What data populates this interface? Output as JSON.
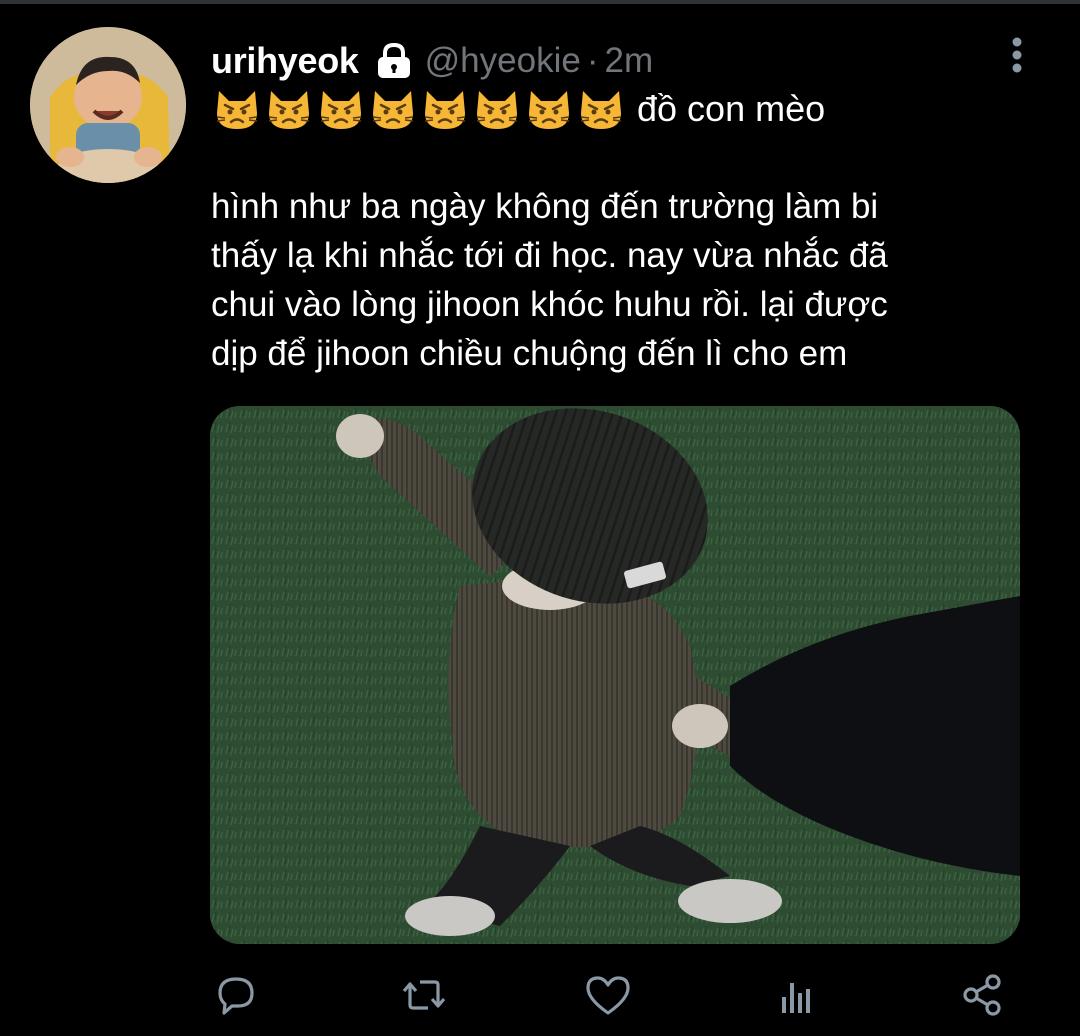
{
  "tweet": {
    "display_name": "urihyeok",
    "name_suffix": "đồ con mèo",
    "handle": "@hyeokie",
    "separator": "·",
    "time": "2m",
    "text_lines": [
      "hình như ba ngày không đến trường làm bi",
      "thấy lạ khi nhắc tới đi học. nay vừa nhắc đã",
      "chui vào lòng jihoon khóc huhu rồi. lại được",
      "dịp để jihoon chiều chuộng đến lì cho em"
    ],
    "name_emoji": [
      "pouting-cat",
      "pouting-cat",
      "pouting-cat",
      "pouting-cat",
      "pouting-cat",
      "pouting-cat",
      "pouting-cat",
      "pouting-cat"
    ],
    "protected": true
  },
  "icons": {
    "lock": "lock-icon",
    "more": "more-vertical-icon",
    "reply": "reply-icon",
    "retweet": "retweet-icon",
    "like": "heart-icon",
    "analytics": "analytics-icon",
    "share": "share-icon"
  },
  "colors": {
    "background": "#000000",
    "text": "#ffffff",
    "muted": "#71767b",
    "icon": "#8b98a5"
  }
}
